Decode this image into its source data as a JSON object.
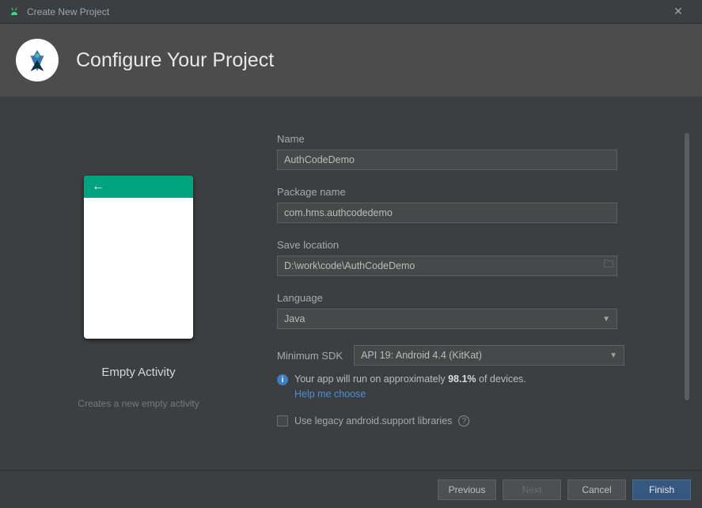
{
  "titlebar": {
    "title": "Create New Project"
  },
  "header": {
    "heading": "Configure Your Project"
  },
  "template": {
    "name": "Empty Activity",
    "description": "Creates a new empty activity"
  },
  "form": {
    "name": {
      "label": "Name",
      "value": "AuthCodeDemo"
    },
    "package": {
      "label": "Package name",
      "value": "com.hms.authcodedemo"
    },
    "location": {
      "label": "Save location",
      "value": "D:\\work\\code\\AuthCodeDemo"
    },
    "language": {
      "label": "Language",
      "value": "Java"
    },
    "minsdk": {
      "label": "Minimum SDK",
      "value": "API 19: Android 4.4 (KitKat)"
    },
    "info_prefix": "Your app will run on approximately ",
    "info_pct": "98.1%",
    "info_suffix": " of devices.",
    "help_link": "Help me choose",
    "legacy_label": "Use legacy android.support libraries"
  },
  "footer": {
    "previous": "Previous",
    "next": "Next",
    "cancel": "Cancel",
    "finish": "Finish"
  }
}
